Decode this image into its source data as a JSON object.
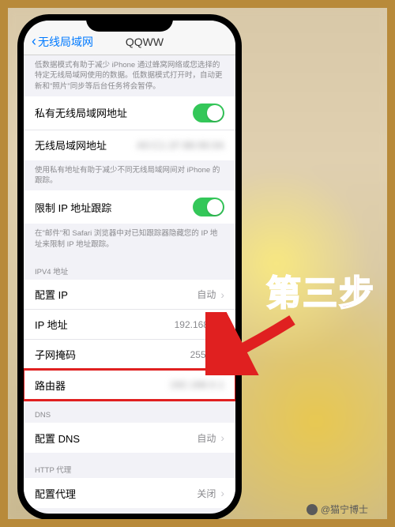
{
  "nav": {
    "back_label": "无线局域网",
    "title": "QQWW"
  },
  "notes": {
    "low_data": "低数据模式有助于减少 iPhone 通过蜂窝网络或您选择的特定无线局域网使用的数据。低数据模式打开时，自动更新和\"照片\"同步等后台任务将会暂停。",
    "private_addr": "使用私有地址有助于减少不同无线局域网间对 iPhone 的跟踪。",
    "limit_tracking": "在\"邮件\"和 Safari 浏览器中对已知跟踪器隐藏您的 IP 地址来限制 IP 地址跟踪。"
  },
  "cells": {
    "private_addr_label": "私有无线局域网地址",
    "wifi_addr_label": "无线局域网地址",
    "wifi_addr_value": "A0:C1:1F:88:06:0A",
    "limit_tracking_label": "限制 IP 地址跟踪"
  },
  "sections": {
    "ipv4_header": "IPV4 地址",
    "dns_header": "DNS",
    "http_proxy_header": "HTTP 代理"
  },
  "ipv4": {
    "configure_ip_label": "配置 IP",
    "configure_ip_value": "自动",
    "ip_addr_label": "IP 地址",
    "ip_addr_value": "192.168.0.2",
    "subnet_label": "子网掩码",
    "subnet_value": "255.255",
    "router_label": "路由器",
    "router_value": "192.168.0.1"
  },
  "dns": {
    "configure_label": "配置 DNS",
    "configure_value": "自动"
  },
  "proxy": {
    "configure_label": "配置代理",
    "configure_value": "关闭"
  },
  "callout": {
    "step_label": "第三步"
  },
  "credit": "@猫宁博士"
}
